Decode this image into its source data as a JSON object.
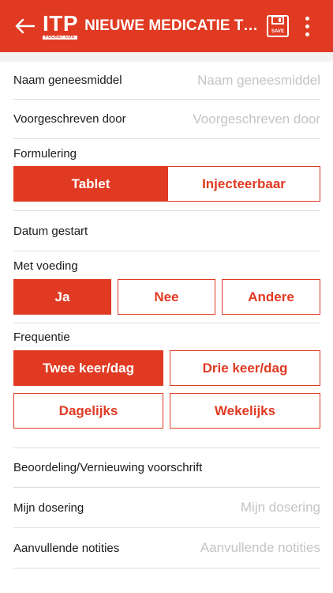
{
  "appbar": {
    "logo": "ITP",
    "logo_sub": "POCKET LOG",
    "title": "NIEUWE MEDICATIE TOEV...",
    "save_label": "SAVE"
  },
  "fields": {
    "drug_name": {
      "label": "Naam geneesmiddel",
      "placeholder": "Naam geneesmiddel"
    },
    "prescribed_by": {
      "label": "Voorgeschreven door",
      "placeholder": "Voorgeschreven door"
    },
    "start_date": {
      "label": "Datum gestart"
    },
    "review": {
      "label": "Beoordeling/Vernieuwing voorschrift"
    },
    "dosage": {
      "label": "Mijn dosering",
      "placeholder": "Mijn dosering"
    },
    "notes": {
      "label": "Aanvullende notities",
      "placeholder": "Aanvullende notities"
    }
  },
  "formulation": {
    "label": "Formulering",
    "options": [
      "Tablet",
      "Injecteerbaar"
    ],
    "selected": "Tablet"
  },
  "with_food": {
    "label": "Met voeding",
    "options": [
      "Ja",
      "Nee",
      "Andere"
    ],
    "selected": "Ja"
  },
  "frequency": {
    "label": "Frequentie",
    "options": [
      "Twee keer/dag",
      "Drie keer/dag",
      "Dagelijks",
      "Wekelijks"
    ],
    "selected": "Twee keer/dag"
  },
  "colors": {
    "accent": "#e03a22",
    "divider": "#dedede"
  }
}
